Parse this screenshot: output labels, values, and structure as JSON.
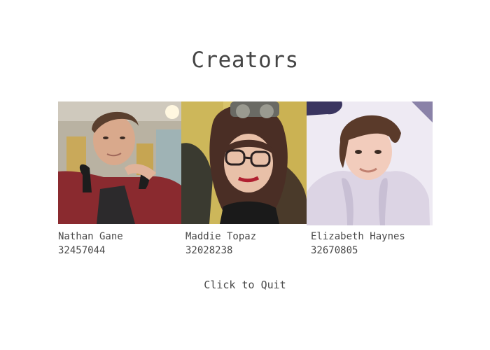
{
  "title": "Creators",
  "creators": [
    {
      "name": "Nathan Gane",
      "id": "32457044"
    },
    {
      "name": "Maddie Topaz",
      "id": "32028238"
    },
    {
      "name": "Elizabeth Haynes",
      "id": "32670805"
    }
  ],
  "quit_label": "Click to Quit"
}
